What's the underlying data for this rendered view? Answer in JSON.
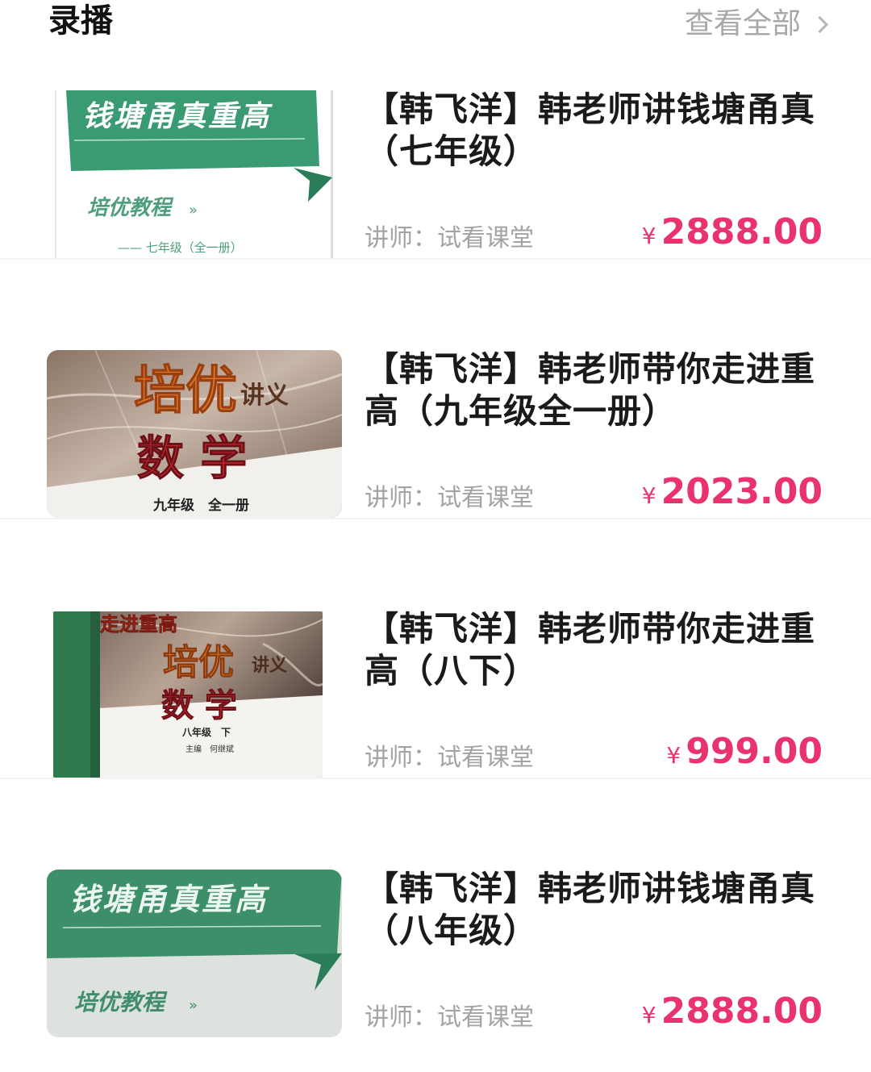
{
  "header": {
    "title": "录播",
    "view_all_label": "查看全部",
    "view_all_icon": "chevron-right-icon"
  },
  "courses": [
    {
      "title_line1": "【韩飞洋】韩老师讲钱塘甬真",
      "title_line2": "（七年级）",
      "lecturer": "讲师：试看课堂",
      "currency": "¥",
      "price": "2888.00",
      "cover": {
        "banner": "钱塘甬真重高",
        "subtitle": "培优教程",
        "subtitle_mark": "»",
        "grade": "—— 七年级（全一册）"
      }
    },
    {
      "title_line1": "【韩飞洋】韩老师带你走进重",
      "title_line2": "高（九年级全一册）",
      "lecturer": "讲师：试看课堂",
      "currency": "¥",
      "price": "2023.00",
      "cover": {
        "big": "培优",
        "small": "讲义",
        "subject": "数 学",
        "grade": "九年级　全一册"
      }
    },
    {
      "title_line1": "【韩飞洋】韩老师带你走进重",
      "title_line2": "高（八下）",
      "lecturer": "讲师：试看课堂",
      "currency": "¥",
      "price": "999.00",
      "cover": {
        "top": "走进重高",
        "big": "培优",
        "small": "讲义",
        "subject": "数 学",
        "grade": "八年级　下",
        "editor": "主编　何继斌"
      }
    },
    {
      "title_line1": "【韩飞洋】韩老师讲钱塘甬真",
      "title_line2": "（八年级）",
      "lecturer": "讲师：试看课堂",
      "currency": "¥",
      "price": "2888.00",
      "cover": {
        "banner": "钱塘甬真重高",
        "subtitle": "培优教程",
        "subtitle_mark": "»"
      }
    }
  ],
  "colors": {
    "price": "#e8336d",
    "muted": "#a3a3a3",
    "banner_green": "#3a9a72"
  }
}
